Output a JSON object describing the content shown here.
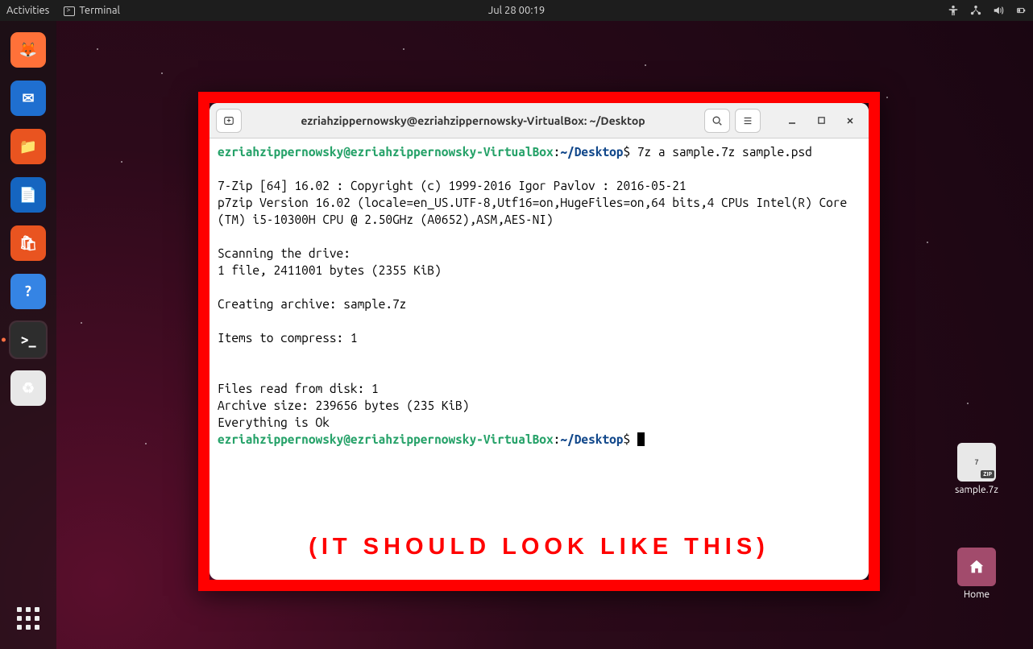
{
  "topbar": {
    "activities": "Activities",
    "app_indicator": "Terminal",
    "datetime": "Jul 28  00:19"
  },
  "dock": {
    "items": [
      {
        "name": "firefox",
        "color": "#ff7139",
        "glyph": "🦊"
      },
      {
        "name": "thunderbird",
        "color": "#1f6fd0",
        "glyph": "✉"
      },
      {
        "name": "files",
        "color": "#e95420",
        "glyph": "📁"
      },
      {
        "name": "writer",
        "color": "#1565c0",
        "glyph": "📄"
      },
      {
        "name": "software",
        "color": "#e95420",
        "glyph": "🛍"
      },
      {
        "name": "help",
        "color": "#3584e4",
        "glyph": "?"
      },
      {
        "name": "terminal",
        "color": "#2d2d2d",
        "glyph": ">_",
        "active": true
      },
      {
        "name": "trash",
        "color": "#e8e8e8",
        "glyph": "♻"
      }
    ]
  },
  "desktop": {
    "sample_label": "sample.7z",
    "home_label": "Home"
  },
  "annotation": {
    "caption": "(IT SHOULD LOOK LIKE THIS)"
  },
  "terminal": {
    "title": "ezriahzippernowsky@ezriahzippernowsky-VirtualBox: ~/Desktop",
    "prompt_user_host": "ezriahzippernowsky@ezriahzippernowsky-VirtualBox",
    "prompt_sep": ":",
    "prompt_path": "~/Desktop",
    "prompt_end": "$",
    "command1": "7z a sample.7z sample.psd",
    "output": "\n7-Zip [64] 16.02 : Copyright (c) 1999-2016 Igor Pavlov : 2016-05-21\np7zip Version 16.02 (locale=en_US.UTF-8,Utf16=on,HugeFiles=on,64 bits,4 CPUs Intel(R) Core(TM) i5-10300H CPU @ 2.50GHz (A0652),ASM,AES-NI)\n\nScanning the drive:\n1 file, 2411001 bytes (2355 KiB)\n\nCreating archive: sample.7z\n\nItems to compress: 1\n\n\nFiles read from disk: 1\nArchive size: 239656 bytes (235 KiB)\nEverything is Ok"
  }
}
